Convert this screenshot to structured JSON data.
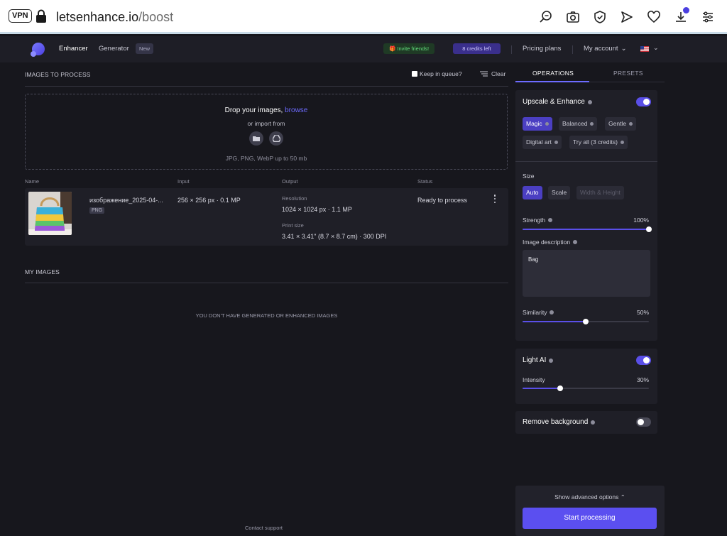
{
  "browser": {
    "vpn": "VPN",
    "url_domain": "letsenhance.io",
    "url_path": "/boost",
    "icons": [
      "search-icon",
      "camera-icon",
      "shield-icon",
      "send-icon",
      "heart-icon",
      "download-icon",
      "settings-icon"
    ]
  },
  "header": {
    "nav": [
      {
        "label": "Enhancer"
      },
      {
        "label": "Generator"
      }
    ],
    "new_badge": "New",
    "invite": "🎁 Invite friends!",
    "credits": "8 credits left",
    "pricing": "Pricing plans",
    "account": "My account",
    "colors": {
      "accent": "#5b4ff0",
      "invite": "#63e07d"
    }
  },
  "left": {
    "images_title": "IMAGES TO PROCESS",
    "keep_queue": "Keep in queue?",
    "clear": "Clear",
    "drop": {
      "title": "Drop your images,",
      "browse": "browse",
      "import": "or import from",
      "note": "JPG, PNG, WebP up to 50 mb"
    },
    "columns": [
      "Name",
      "Input",
      "Output",
      "Status"
    ],
    "file": {
      "name": "изображение_2025-04-...",
      "format": "PNG",
      "input": "256 × 256 px · 0.1 MP",
      "resolution_label": "Resolution",
      "resolution": "1024 × 1024 px · 1.1 MP",
      "print_label": "Print size",
      "print": "3.41 × 3.41\" (8.7 × 8.7 cm) · 300 DPI",
      "status": "Ready to process"
    },
    "my_images_title": "MY IMAGES",
    "empty": "YOU DON'T HAVE GENERATED OR ENHANCED IMAGES",
    "contact": "Contact support"
  },
  "right": {
    "tabs": [
      "OPERATIONS",
      "PRESETS"
    ],
    "upscale": {
      "title": "Upscale & Enhance",
      "enabled": true,
      "modes": [
        "Magic",
        "Balanced",
        "Gentle",
        "Digital art",
        "Try all (3 credits)"
      ],
      "size_label": "Size",
      "size_options": [
        "Auto",
        "Scale",
        "Width & Height"
      ],
      "strength_label": "Strength",
      "strength_value": "100%",
      "strength": 1.0,
      "desc_label": "Image description",
      "desc_value": "Bag",
      "similarity_label": "Similarity",
      "similarity_value": "50%",
      "similarity": 0.5
    },
    "light_ai": {
      "title": "Light AI",
      "enabled": true,
      "intensity_label": "Intensity",
      "intensity_value": "30%",
      "intensity": 0.3
    },
    "remove_bg": {
      "title": "Remove background",
      "enabled": false
    },
    "advanced": "Show advanced options ⌃",
    "start": "Start processing"
  }
}
